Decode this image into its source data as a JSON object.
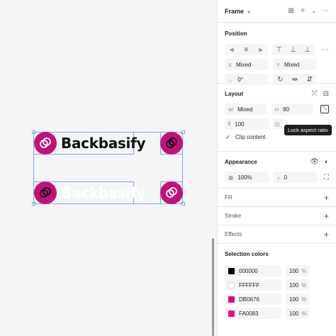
{
  "canvas": {
    "wordmark_dark": "Backbasify",
    "wordmark_light": "Backbasify",
    "brand_color": "#c2127a"
  },
  "panel": {
    "header": {
      "title": "Frame",
      "chevron": "⌄"
    },
    "position": {
      "title": "Position",
      "x_label": "X",
      "x_value": "Mixed",
      "y_label": "Y",
      "y_value": "Mixed",
      "rotation_value": "0°"
    },
    "layout": {
      "title": "Layout",
      "w_label": "W",
      "w_value": "Mixed",
      "h_label": "H",
      "h_value": "80",
      "gap_value": "100",
      "tooltip": "Lock aspect ratio",
      "clip_label": "Clip content"
    },
    "appearance": {
      "title": "Appearance",
      "opacity_value": "100%",
      "radius_value": "0"
    },
    "fill": {
      "title": "Fill"
    },
    "stroke": {
      "title": "Stroke"
    },
    "effects": {
      "title": "Effects"
    },
    "selection_colors": {
      "title": "Selection colors",
      "items": [
        {
          "hex": "000000",
          "opacity": "100",
          "pct": "%",
          "color": "#000000"
        },
        {
          "hex": "FFFFFF",
          "opacity": "100",
          "pct": "%",
          "color": "#FFFFFF"
        },
        {
          "hex": "DB0676",
          "opacity": "100",
          "pct": "%",
          "color": "#DB0676"
        },
        {
          "hex": "FA0083",
          "opacity": "100",
          "pct": "%",
          "color": "#FA0083"
        }
      ]
    }
  }
}
